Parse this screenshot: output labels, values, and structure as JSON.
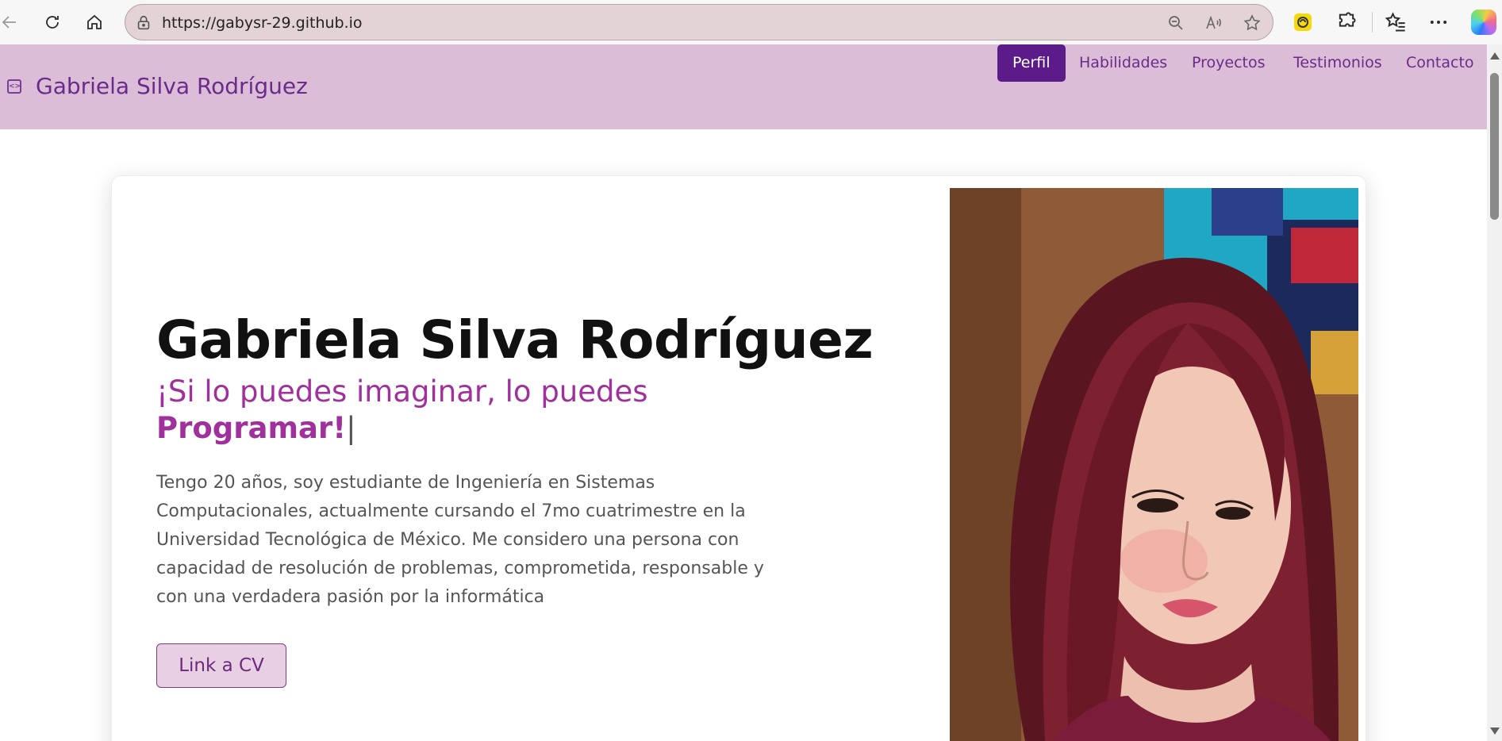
{
  "browser": {
    "url": "https://gabysr-29.github.io"
  },
  "site": {
    "brand": "Gabriela Silva Rodríguez",
    "nav": [
      {
        "label": "Perfil",
        "active": true
      },
      {
        "label": "Habilidades",
        "active": false
      },
      {
        "label": "Proyectos",
        "active": false
      },
      {
        "label": "Testimonios",
        "active": false
      },
      {
        "label": "Contacto",
        "active": false
      }
    ]
  },
  "hero": {
    "title": "Gabriela Silva Rodríguez",
    "tagline_prefix": "¡Si lo puedes imaginar, lo puedes",
    "tagline_strong": "Programar!",
    "tagline_cursor": "|",
    "bio": "Tengo 20 años, soy estudiante de Ingeniería en Sistemas Computacionales, actualmente cursando el 7mo cuatrimestre en la Universidad Tecnológica de México. Me considero una persona con capacidad de resolución de problemas, comprometida, responsable y con una verdadera pasión por la informática",
    "cv_button": "Link a CV"
  },
  "colors": {
    "nav_bg": "#dcbdd7",
    "accent": "#5b1c8a",
    "tagline": "#a0319c"
  }
}
